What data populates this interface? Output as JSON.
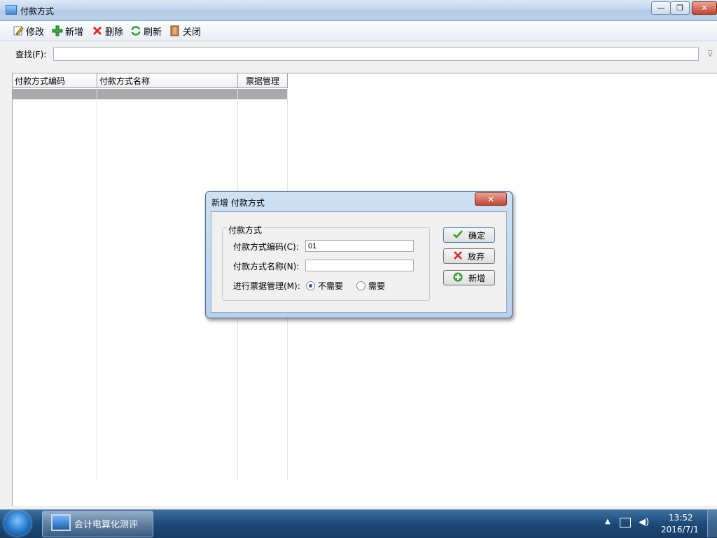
{
  "window": {
    "title": "付款方式",
    "min": "—",
    "max": "❐",
    "close": "✕"
  },
  "toolbar": {
    "edit": "修改",
    "add": "新增",
    "delete": "删除",
    "refresh": "刷新",
    "close": "关闭"
  },
  "search": {
    "label": "查找(F):",
    "value": ""
  },
  "grid": {
    "columns": [
      "付款方式编码",
      "付款方式名称",
      "票据管理"
    ],
    "rows": []
  },
  "dialog": {
    "title": "新增 付款方式",
    "close": "✕",
    "group_title": "付款方式",
    "code_label": "付款方式编码(C):",
    "code_value": "01",
    "name_label": "付款方式名称(N):",
    "name_value": "",
    "bill_label": "进行票据管理(M):",
    "options": [
      "不需要",
      "需要"
    ],
    "selected_option": "不需要",
    "ok": "确定",
    "cancel": "放弃",
    "new": "新增"
  },
  "taskbar": {
    "app_label": "会计电算化测评",
    "time": "13:52",
    "date": "2016/7/1"
  },
  "icons": [
    "pencil-icon",
    "plus-icon",
    "delete-x-icon",
    "refresh-icon",
    "door-icon",
    "filter-icon",
    "check-icon",
    "network-icon",
    "volume-icon"
  ]
}
